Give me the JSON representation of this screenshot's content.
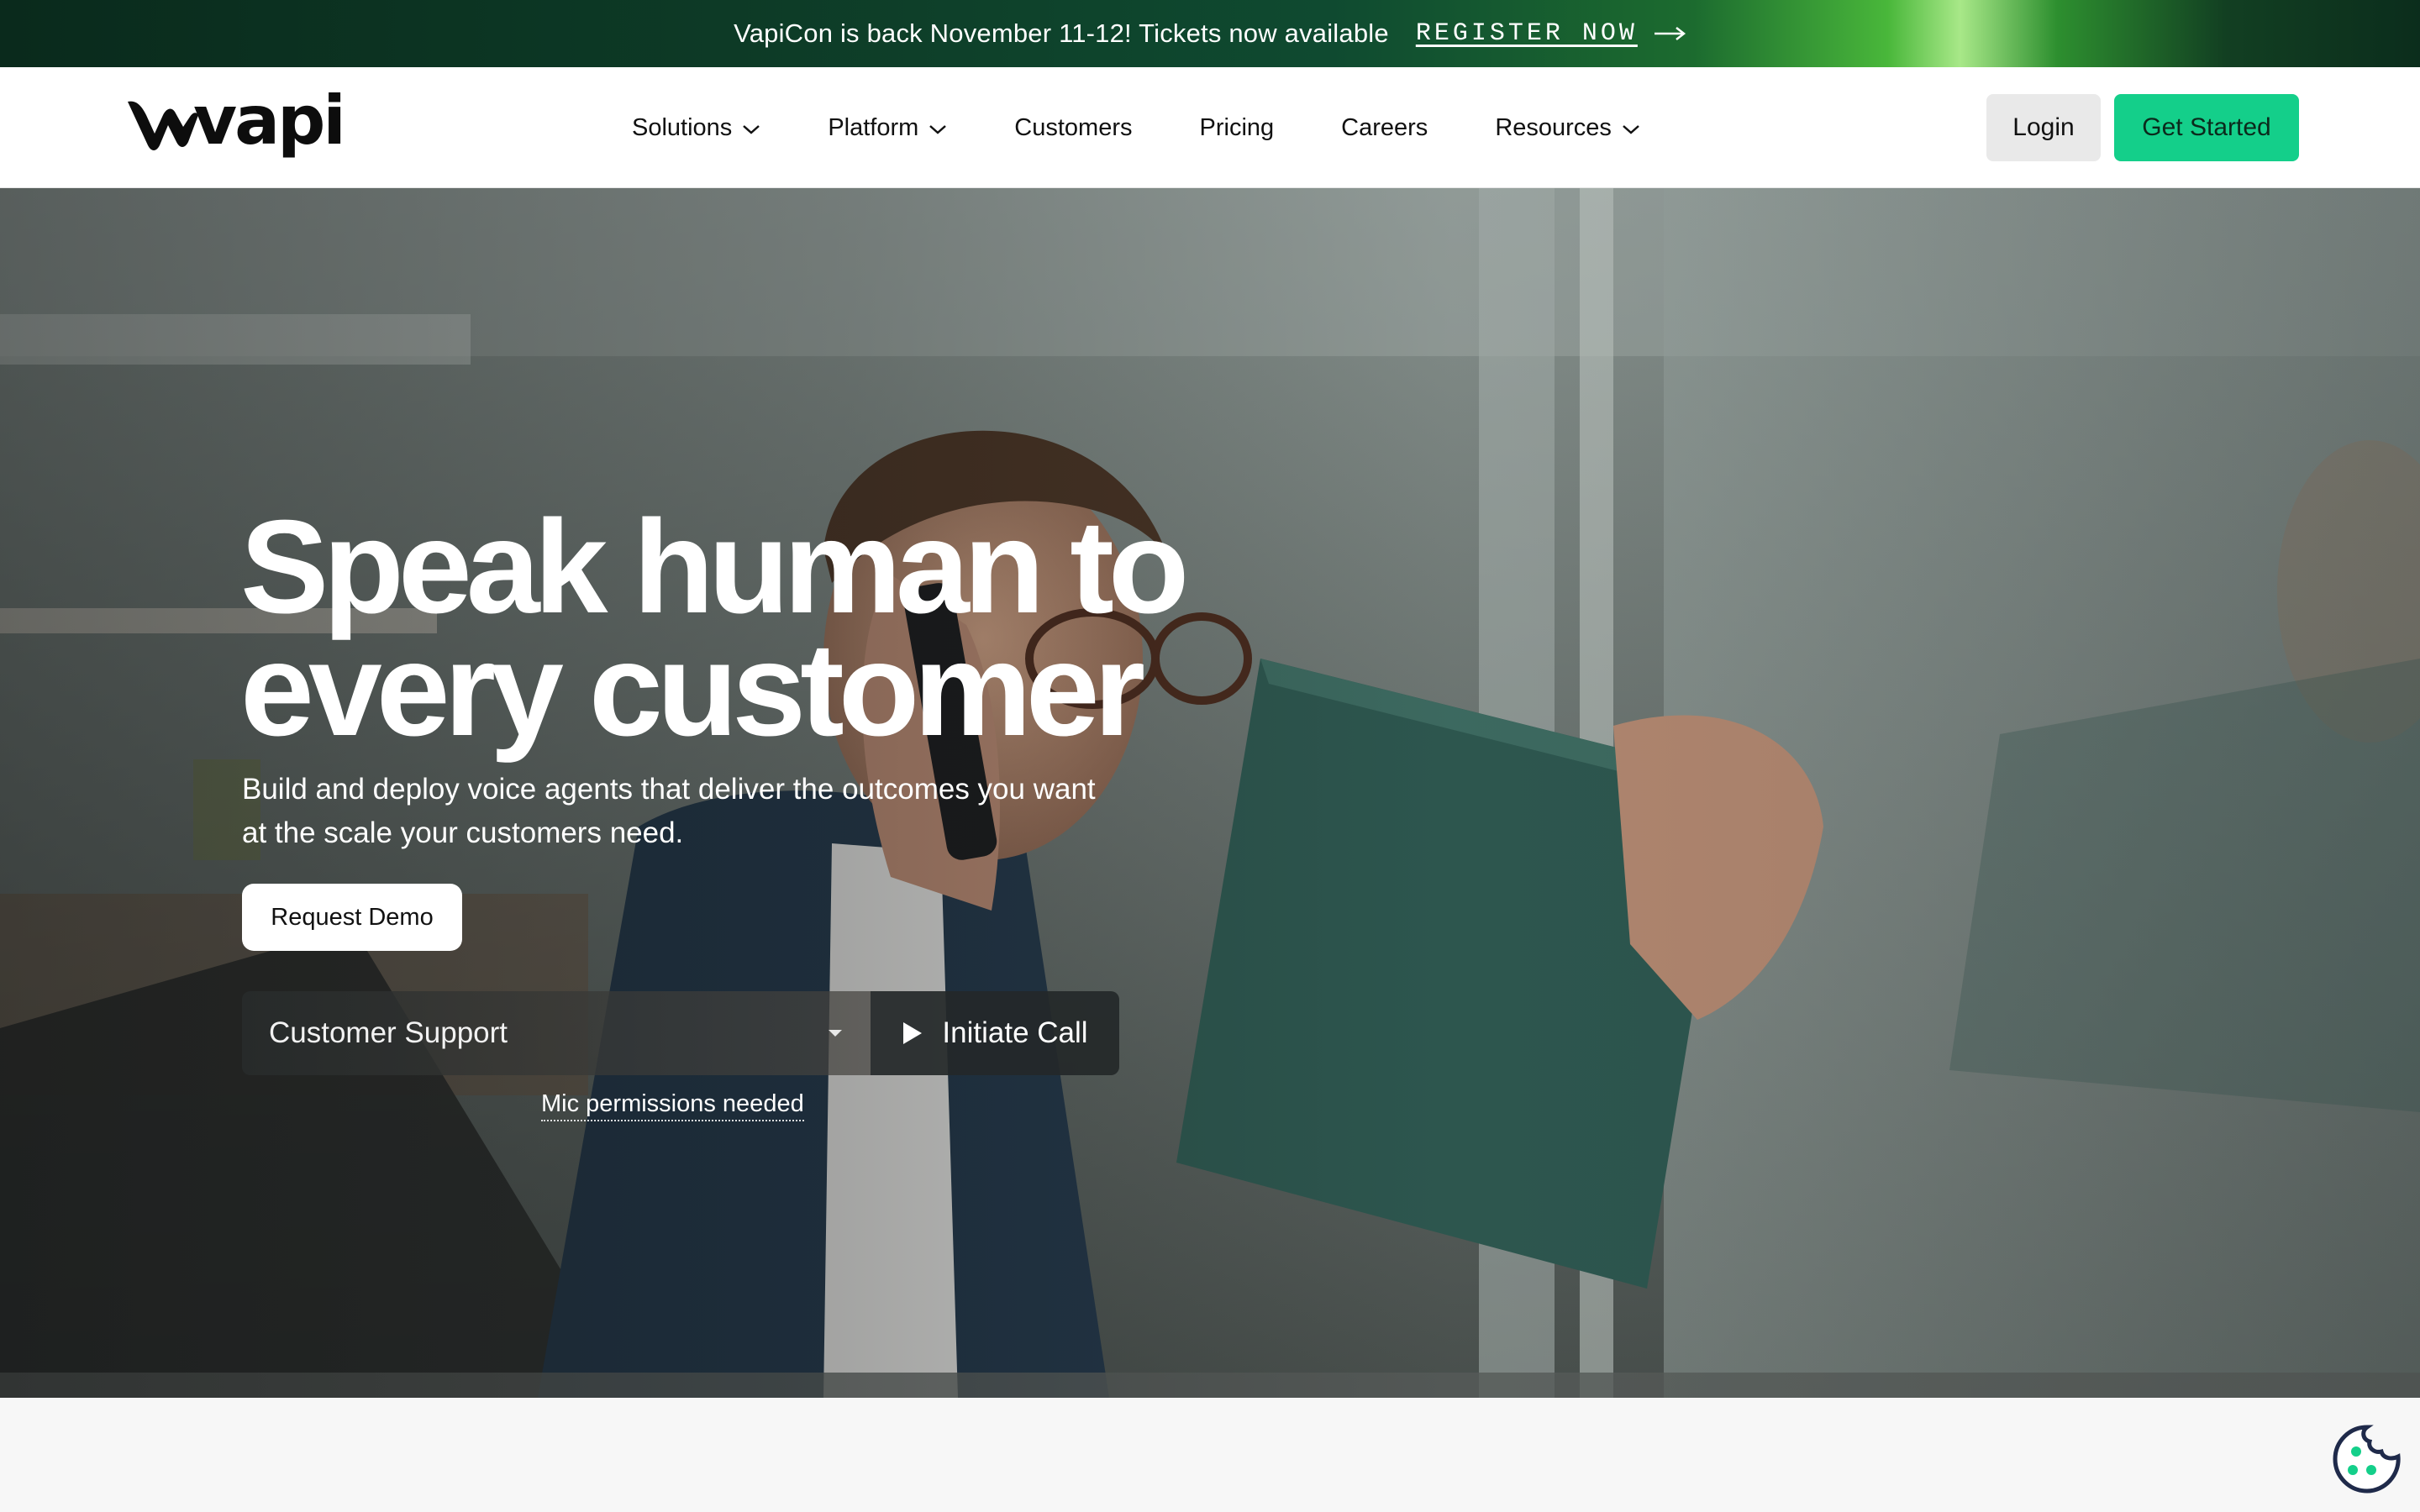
{
  "announcement": {
    "text": "VapiCon is back November 11-12! Tickets now available",
    "link_label": "REGISTER NOW"
  },
  "nav": {
    "logo_text": "vapi",
    "items": [
      {
        "label": "Solutions",
        "dropdown": true
      },
      {
        "label": "Platform",
        "dropdown": true
      },
      {
        "label": "Customers",
        "dropdown": false
      },
      {
        "label": "Pricing",
        "dropdown": false
      },
      {
        "label": "Careers",
        "dropdown": false
      },
      {
        "label": "Resources",
        "dropdown": true
      }
    ],
    "login_label": "Login",
    "cta_label": "Get Started"
  },
  "hero": {
    "title_line1": "Speak human to",
    "title_line2": "every customer",
    "subtitle": "Build and deploy voice agents that deliver the outcomes you want at the scale your customers need.",
    "demo_label": "Request Demo",
    "select_value": "Customer Support",
    "call_label": "Initiate Call",
    "mic_note": "Mic permissions needed"
  },
  "icons": {
    "arrow": "arrow-right-icon",
    "chevron": "chevron-down-icon",
    "caret": "caret-down-icon",
    "play": "play-icon",
    "cookie": "cookie-icon"
  },
  "colors": {
    "accent": "#14cf8a",
    "announcement_bg": "#0d3a26",
    "cookie_dots": "#14cf8a"
  }
}
